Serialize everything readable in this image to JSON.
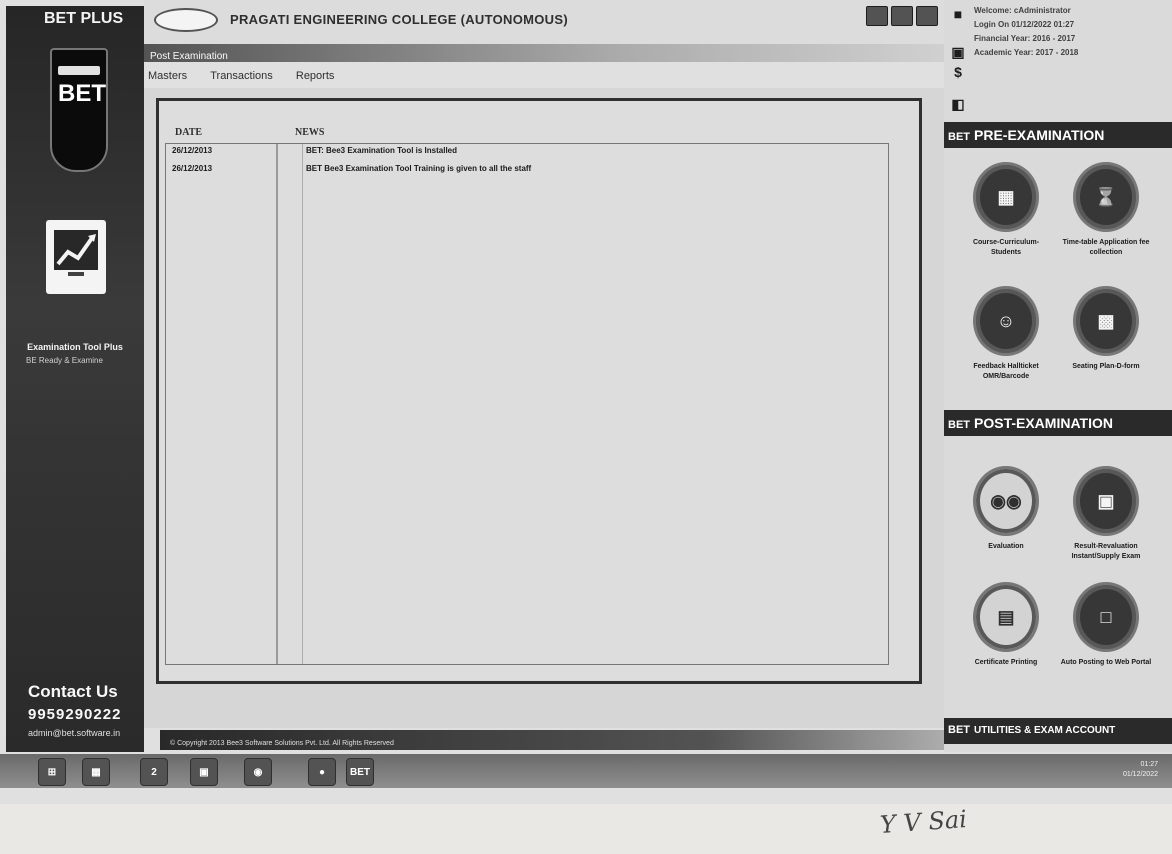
{
  "app": {
    "brand": "BET PLUS"
  },
  "sidebar": {
    "badge_pill": "B-tree",
    "badge_text": "BET",
    "exam_tool_label": "Examination Tool Plus",
    "exam_tool_tagline": "BE Ready & Examine",
    "contact_title": "Contact Us",
    "contact_phone": "9959290222",
    "contact_email": "admin@bet.software.in"
  },
  "header": {
    "college_name": "PRAGATI ENGINEERING COLLEGE (AUTONOMOUS)",
    "subtitle": "Post Examination",
    "menu": [
      "Masters",
      "Transactions",
      "Reports"
    ]
  },
  "news": {
    "date_header": "DATE",
    "news_header": "NEWS",
    "rows": [
      {
        "date": "26/12/2013",
        "text": "BET: Bee3 Examination Tool is Installed"
      },
      {
        "date": "26/12/2013",
        "text": "BET Bee3 Examination Tool Training is given to all the staff"
      }
    ]
  },
  "footer": {
    "copyright": "© Copyright 2013 Bee3 Software Solutions Pvt. Ltd. All Rights Reserved"
  },
  "user": {
    "welcome": "Welcome: cAdministrator",
    "login": "Login On 01/12/2022 01:27",
    "financial_year": "Financial Year: 2016 - 2017",
    "academic_year": "Academic Year: 2017 - 2018"
  },
  "pre_exam": {
    "title": "PRE-EXAMINATION",
    "tiles": [
      {
        "label": "Course-Curriculum-Students",
        "icon": "course-icon"
      },
      {
        "label": "Time-table Application fee collection",
        "icon": "hourglass-icon"
      },
      {
        "label": "Feedback Hallticket OMR/Barcode",
        "icon": "feedback-icon"
      },
      {
        "label": "Seating Plan-D-form",
        "icon": "seating-icon"
      }
    ]
  },
  "post_exam": {
    "title": "POST-EXAMINATION",
    "tiles": [
      {
        "label": "Evaluation",
        "icon": "evaluation-icon"
      },
      {
        "label": "Result-Revaluation Instant/Supply Exam",
        "icon": "result-icon"
      },
      {
        "label": "Certificate Printing",
        "icon": "certificate-icon"
      },
      {
        "label": "Auto Posting to Web Portal",
        "icon": "web-portal-icon"
      }
    ]
  },
  "utilities": {
    "title": "UTILITIES & EXAM ACCOUNT"
  },
  "taskbar": {
    "time": "01:27",
    "date": "01/12/2022",
    "bet_label": "BET"
  },
  "signature_text": "Y V Sai"
}
